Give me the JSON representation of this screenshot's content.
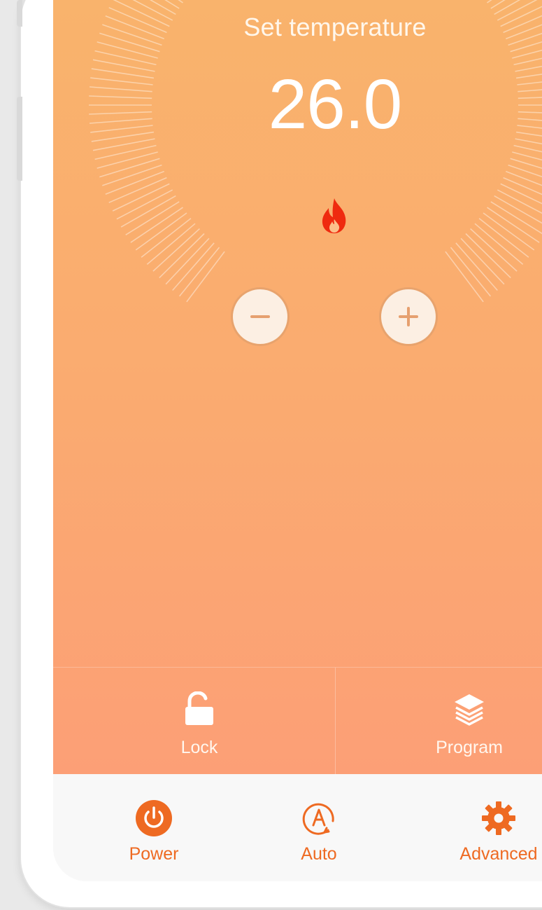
{
  "thermostat": {
    "setpoint_label": "Set temperature",
    "setpoint_value": "26.0",
    "heating_icon": "flame-icon",
    "decrease_icon": "minus-icon",
    "increase_icon": "plus-icon"
  },
  "actions": [
    {
      "label": "Lock",
      "icon": "unlock-icon"
    },
    {
      "label": "Program",
      "icon": "layers-icon"
    }
  ],
  "nav": [
    {
      "label": "Power",
      "icon": "power-icon"
    },
    {
      "label": "Auto",
      "icon": "auto-mode-icon"
    },
    {
      "label": "Advanced",
      "icon": "gear-icon"
    }
  ],
  "colors": {
    "gradient_top": "#f9b36c",
    "gradient_bottom": "#fc9f76",
    "accent": "#ee6a22",
    "flame": "#ef2a0f",
    "nav_background": "#f8f8f8"
  }
}
